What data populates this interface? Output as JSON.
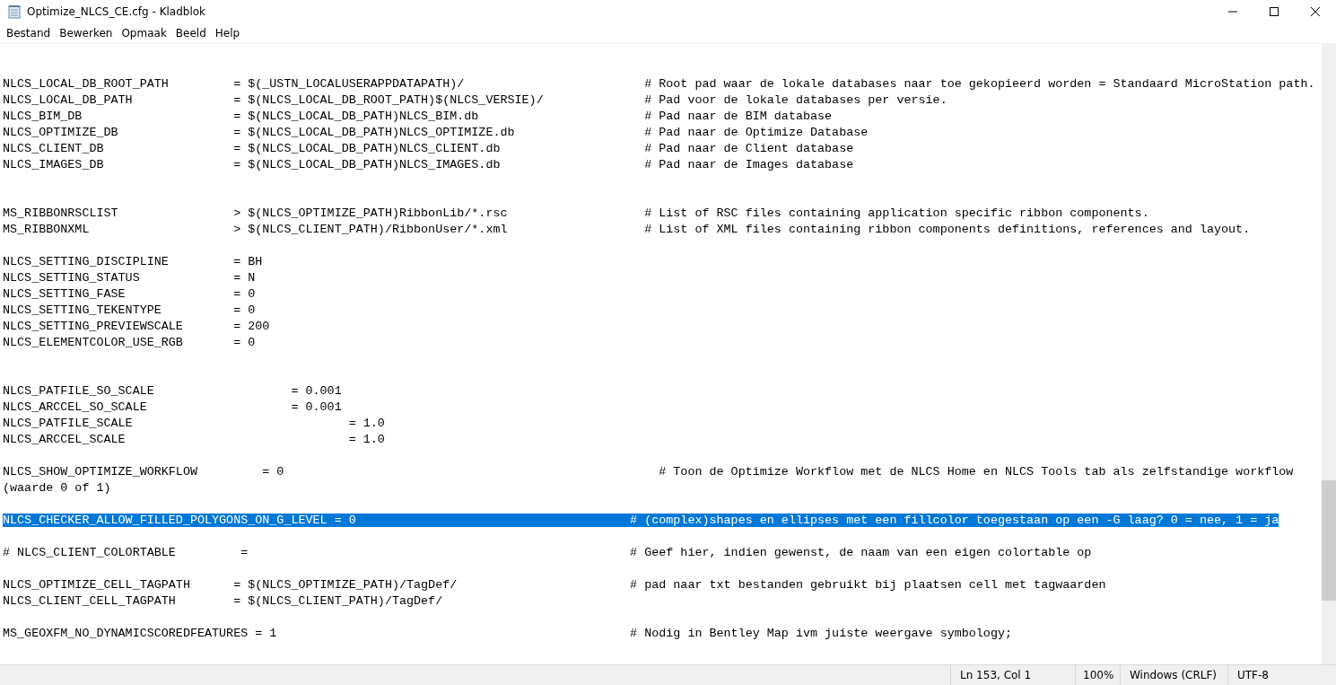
{
  "window": {
    "title": "Optimize_NLCS_CE.cfg - Kladblok"
  },
  "menu": [
    "Bestand",
    "Bewerken",
    "Opmaak",
    "Beeld",
    "Help"
  ],
  "editor": {
    "lines": [
      {
        "kind": "blank"
      },
      {
        "kind": "blank"
      },
      {
        "kind": "text",
        "text": "NLCS_LOCAL_DB_ROOT_PATH         = $(_USTN_LOCALUSERAPPDATAPATH)/                         # Root pad waar de lokale databases naar toe gekopieerd worden = Standaard MicroStation path.",
        "selected": false
      },
      {
        "kind": "text",
        "text": "NLCS_LOCAL_DB_PATH              = $(NLCS_LOCAL_DB_ROOT_PATH)$(NLCS_VERSIE)/              # Pad voor de lokale databases per versie.",
        "selected": false
      },
      {
        "kind": "text",
        "text": "NLCS_BIM_DB                     = $(NLCS_LOCAL_DB_PATH)NLCS_BIM.db                       # Pad naar de BIM database",
        "selected": false
      },
      {
        "kind": "text",
        "text": "NLCS_OPTIMIZE_DB                = $(NLCS_LOCAL_DB_PATH)NLCS_OPTIMIZE.db                  # Pad naar de Optimize Database",
        "selected": false
      },
      {
        "kind": "text",
        "text": "NLCS_CLIENT_DB                  = $(NLCS_LOCAL_DB_PATH)NLCS_CLIENT.db                    # Pad naar de Client database",
        "selected": false
      },
      {
        "kind": "text",
        "text": "NLCS_IMAGES_DB                  = $(NLCS_LOCAL_DB_PATH)NLCS_IMAGES.db                    # Pad naar de Images database",
        "selected": false
      },
      {
        "kind": "blank"
      },
      {
        "kind": "blank"
      },
      {
        "kind": "text",
        "text": "MS_RIBBONRSCLIST                > $(NLCS_OPTIMIZE_PATH)RibbonLib/*.rsc                   # List of RSC files containing application specific ribbon components.",
        "selected": false
      },
      {
        "kind": "text",
        "text": "MS_RIBBONXML                    > $(NLCS_CLIENT_PATH)/RibbonUser/*.xml                   # List of XML files containing ribbon components definitions, references and layout.",
        "selected": false
      },
      {
        "kind": "blank"
      },
      {
        "kind": "text",
        "text": "NLCS_SETTING_DISCIPLINE         = BH",
        "selected": false
      },
      {
        "kind": "text",
        "text": "NLCS_SETTING_STATUS             = N",
        "selected": false
      },
      {
        "kind": "text",
        "text": "NLCS_SETTING_FASE               = 0",
        "selected": false
      },
      {
        "kind": "text",
        "text": "NLCS_SETTING_TEKENTYPE          = 0",
        "selected": false
      },
      {
        "kind": "text",
        "text": "NLCS_SETTING_PREVIEWSCALE       = 200",
        "selected": false
      },
      {
        "kind": "text",
        "text": "NLCS_ELEMENTCOLOR_USE_RGB       = 0",
        "selected": false
      },
      {
        "kind": "blank"
      },
      {
        "kind": "blank"
      },
      {
        "kind": "text",
        "text": "NLCS_PATFILE_SO_SCALE                   = 0.001",
        "selected": false
      },
      {
        "kind": "text",
        "text": "NLCS_ARCCEL_SO_SCALE                    = 0.001",
        "selected": false
      },
      {
        "kind": "text",
        "text": "NLCS_PATFILE_SCALE                              = 1.0",
        "selected": false
      },
      {
        "kind": "text",
        "text": "NLCS_ARCCEL_SCALE                               = 1.0",
        "selected": false
      },
      {
        "kind": "blank"
      },
      {
        "kind": "text",
        "text": "NLCS_SHOW_OPTIMIZE_WORKFLOW         = 0                                                    # Toon de Optimize Workflow met de NLCS Home en NLCS Tools tab als zelfstandige workflow",
        "selected": false
      },
      {
        "kind": "text",
        "text": "(waarde 0 of 1)",
        "selected": false
      },
      {
        "kind": "blank"
      },
      {
        "kind": "text",
        "text": "NLCS_CHECKER_ALLOW_FILLED_POLYGONS_ON_G_LEVEL = 0                                      # (complex)shapes en ellipses met een fillcolor toegestaan op een -G laag? 0 = nee, 1 = ja",
        "selected": true
      },
      {
        "kind": "blank"
      },
      {
        "kind": "text",
        "text": "# NLCS_CLIENT_COLORTABLE         =                                                     # Geef hier, indien gewenst, de naam van een eigen colortable op",
        "selected": false
      },
      {
        "kind": "blank"
      },
      {
        "kind": "text",
        "text": "NLCS_OPTIMIZE_CELL_TAGPATH      = $(NLCS_OPTIMIZE_PATH)/TagDef/                        # pad naar txt bestanden gebruikt bij plaatsen cell met tagwaarden",
        "selected": false
      },
      {
        "kind": "text",
        "text": "NLCS_CLIENT_CELL_TAGPATH        = $(NLCS_CLIENT_PATH)/TagDef/",
        "selected": false
      },
      {
        "kind": "blank"
      },
      {
        "kind": "text",
        "text": "MS_GEOXFM_NO_DYNAMICSCOREDFEATURES = 1                                                 # Nodig in Bentley Map ivm juiste weergave symbology;",
        "selected": false
      },
      {
        "kind": "blank"
      }
    ]
  },
  "status_bar": [
    "Ln 153, Col 1",
    "100%",
    "Windows (CRLF)",
    "UTF-8"
  ]
}
